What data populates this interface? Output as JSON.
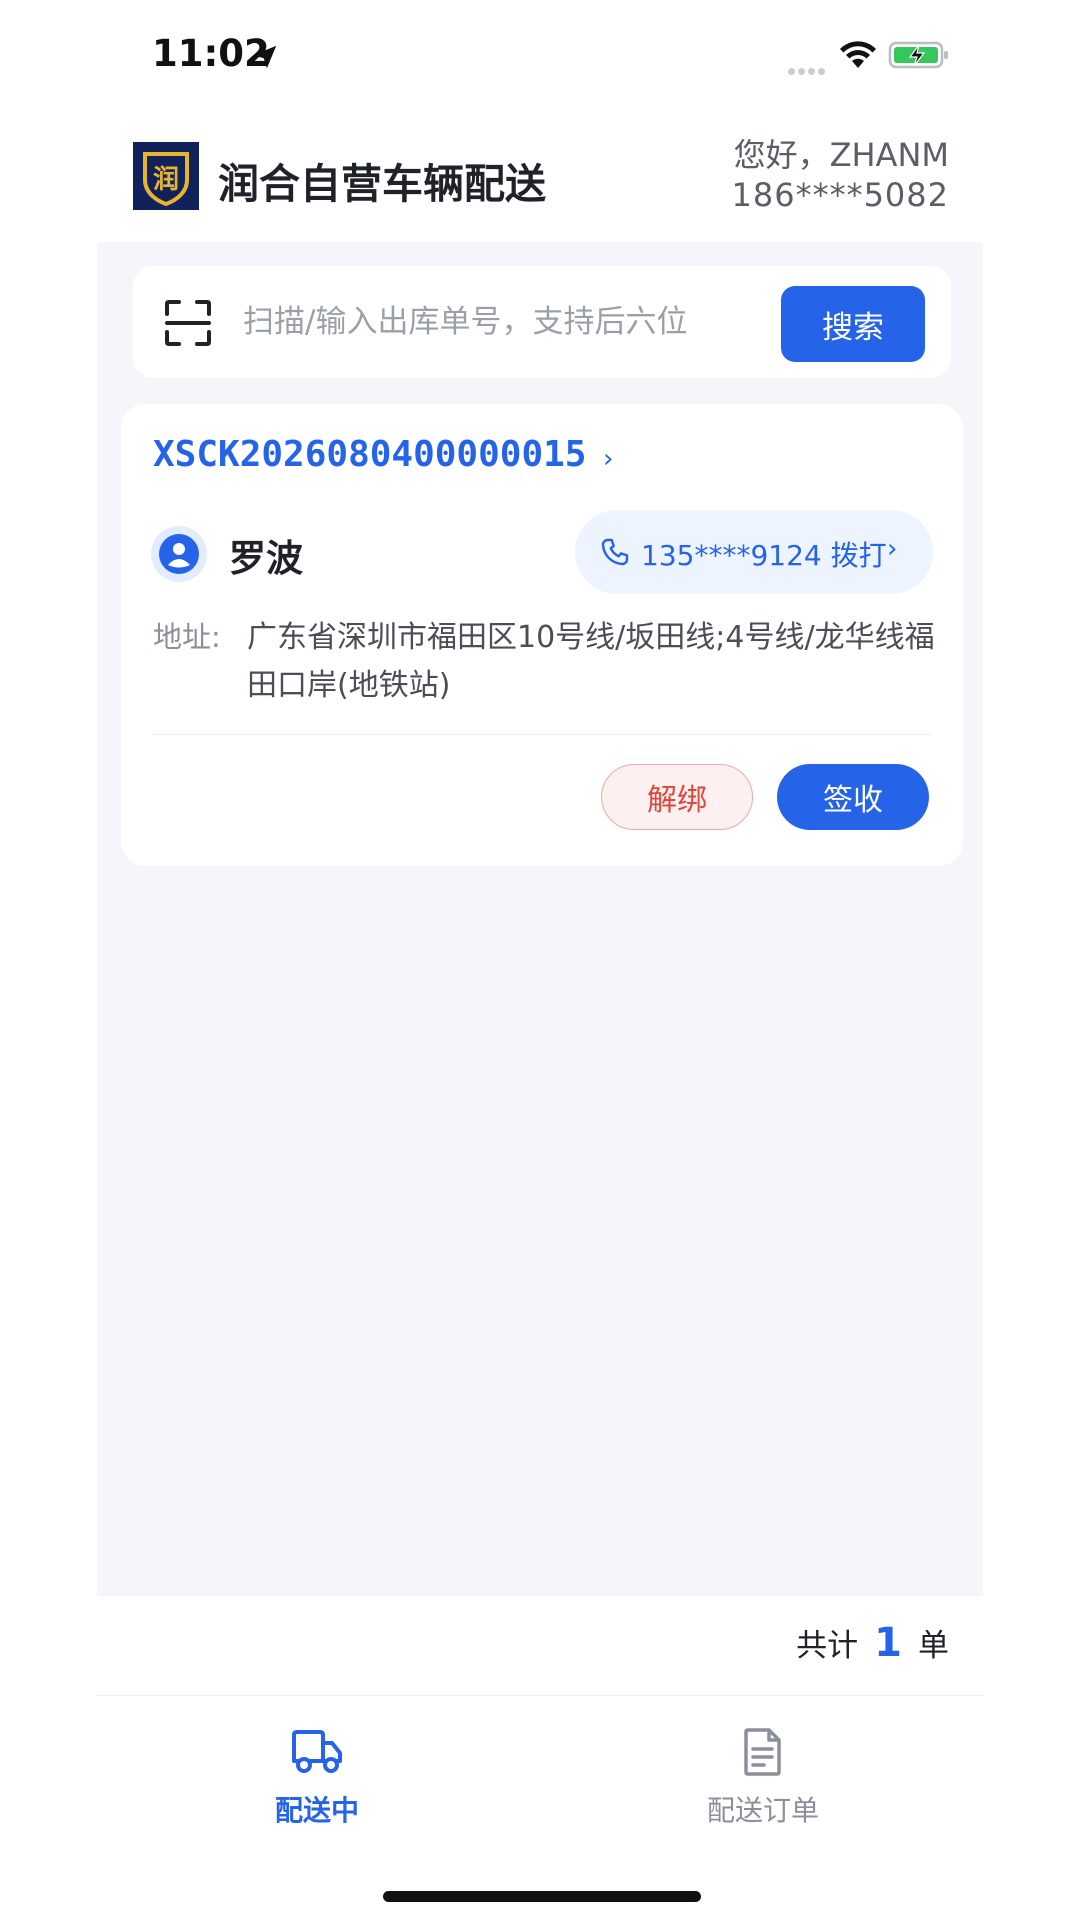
{
  "status_bar": {
    "time": "11:02"
  },
  "header": {
    "app_title": "润合自营车辆配送",
    "logo_text": "润",
    "greeting": "您好，ZHANM",
    "phone": "186****5082"
  },
  "search": {
    "placeholder": "扫描/输入出库单号，支持后六位",
    "button_label": "搜索"
  },
  "order": {
    "order_no": "XSCK2026080400000015",
    "customer_name": "罗波",
    "call_label": "135****9124 拨打",
    "address_label": "地址:",
    "address": "广东省深圳市福田区10号线/坂田线;4号线/龙华线福田口岸(地铁站)",
    "unbind_label": "解绑",
    "sign_label": "签收"
  },
  "summary": {
    "prefix": "共计",
    "count": "1",
    "suffix": "单"
  },
  "tabs": [
    {
      "label": "配送中",
      "icon": "truck-icon",
      "active": true
    },
    {
      "label": "配送订单",
      "icon": "document-icon",
      "active": false
    }
  ],
  "colors": {
    "accent": "#2563e8",
    "danger": "#e0463c",
    "background": "#f4f6fa"
  }
}
